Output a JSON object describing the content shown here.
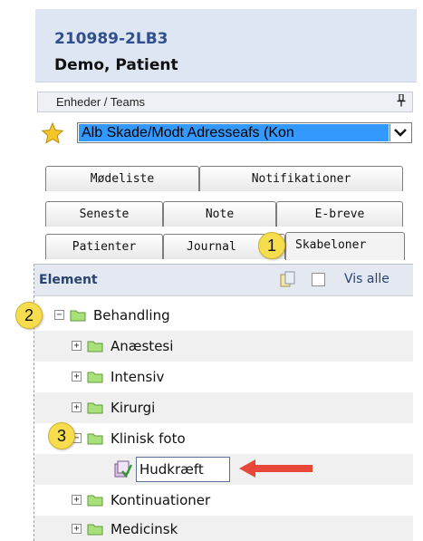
{
  "patient": {
    "id": "210989-2LB3",
    "name": "Demo, Patient"
  },
  "teams": {
    "label": "Enheder / Teams",
    "selected": "Alb Skade/Modt Adresseafs (Kon"
  },
  "tabs": {
    "row1": [
      "Mødeliste",
      "Notifikationer"
    ],
    "row2": [
      "Seneste",
      "Note",
      "E-breve"
    ],
    "row3": [
      "Patienter",
      "Journal",
      "Skabeloner"
    ]
  },
  "element_panel": {
    "title": "Element",
    "show_all_label": "Vis alle"
  },
  "tree": [
    "Behandling",
    "Anæstesi",
    "Intensiv",
    "Kirurgi",
    "Klinisk foto",
    "Hudkræft",
    "Kontinuationer",
    "Medicinsk"
  ],
  "callouts": [
    "1",
    "2",
    "3"
  ],
  "colors": {
    "accent_blue": "#3399ff",
    "callout_yellow": "#f5dd4e",
    "arrow_red": "#e8473a",
    "folder_green": "#a8e07a"
  }
}
